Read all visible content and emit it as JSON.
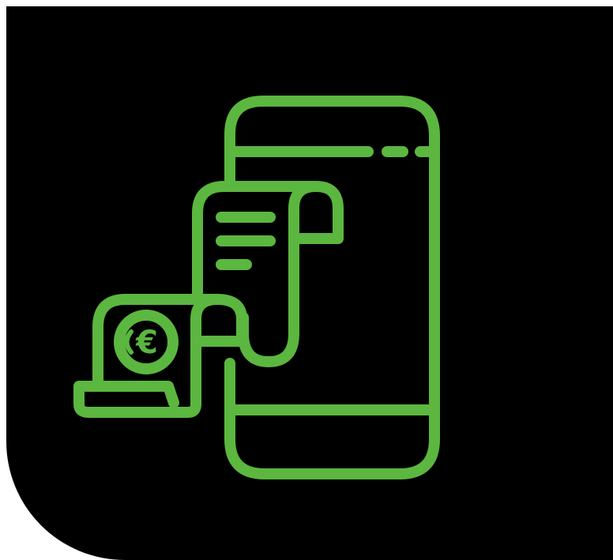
{
  "illustration": {
    "name": "mobile-invoice-payment-icon",
    "accent_color": "#5bb73f",
    "background_color": "#000000",
    "currency_symbol": "€",
    "parts": [
      "smartphone-outline",
      "receipt-scroll",
      "euro-coin-scroll"
    ]
  }
}
